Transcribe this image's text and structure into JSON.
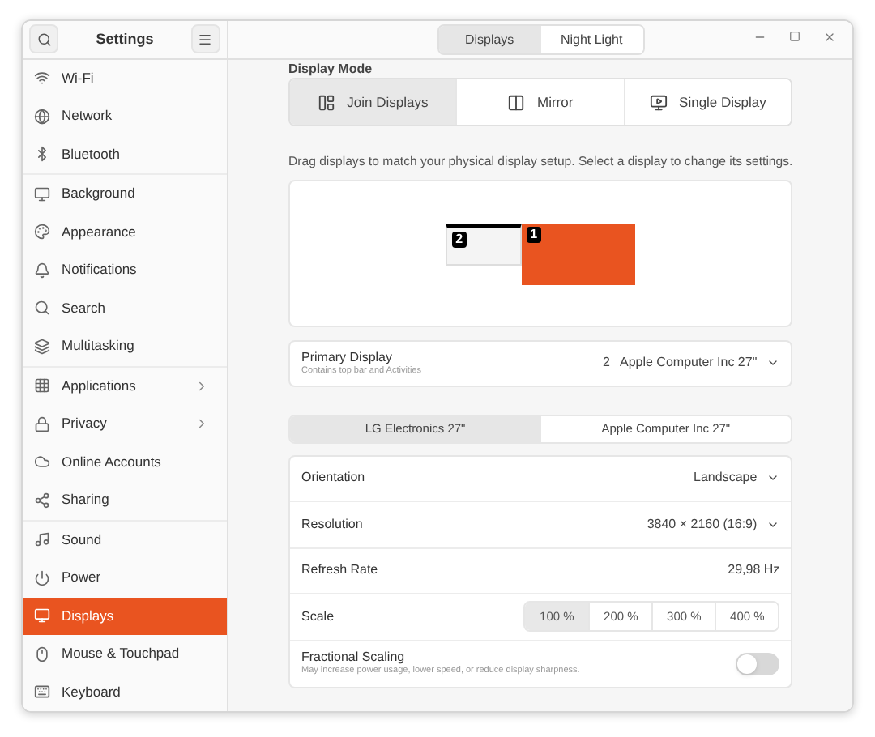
{
  "sidebar": {
    "title": "Settings",
    "groups": [
      [
        {
          "label": "Wi-Fi",
          "selected": false,
          "has_submenu": false
        },
        {
          "label": "Network",
          "selected": false,
          "has_submenu": false
        },
        {
          "label": "Bluetooth",
          "selected": false,
          "has_submenu": false
        }
      ],
      [
        {
          "label": "Background",
          "selected": false,
          "has_submenu": false
        },
        {
          "label": "Appearance",
          "selected": false,
          "has_submenu": false
        },
        {
          "label": "Notifications",
          "selected": false,
          "has_submenu": false
        },
        {
          "label": "Search",
          "selected": false,
          "has_submenu": false
        },
        {
          "label": "Multitasking",
          "selected": false,
          "has_submenu": false
        }
      ],
      [
        {
          "label": "Applications",
          "selected": false,
          "has_submenu": true
        },
        {
          "label": "Privacy",
          "selected": false,
          "has_submenu": true
        },
        {
          "label": "Online Accounts",
          "selected": false,
          "has_submenu": false
        },
        {
          "label": "Sharing",
          "selected": false,
          "has_submenu": false
        }
      ],
      [
        {
          "label": "Sound",
          "selected": false,
          "has_submenu": false
        },
        {
          "label": "Power",
          "selected": false,
          "has_submenu": false
        },
        {
          "label": "Displays",
          "selected": true,
          "has_submenu": false
        },
        {
          "label": "Mouse & Touchpad",
          "selected": false,
          "has_submenu": false
        },
        {
          "label": "Keyboard",
          "selected": false,
          "has_submenu": false
        }
      ]
    ]
  },
  "header": {
    "tabs": [
      {
        "label": "Displays",
        "selected": true
      },
      {
        "label": "Night Light",
        "selected": false
      }
    ]
  },
  "display_mode": {
    "heading": "Display Mode",
    "options": [
      {
        "label": "Join Displays",
        "selected": true
      },
      {
        "label": "Mirror",
        "selected": false
      },
      {
        "label": "Single Display",
        "selected": false
      }
    ],
    "description": "Drag displays to match your physical display setup. Select a display to change its settings."
  },
  "arrangement": {
    "displays": [
      {
        "number": "2",
        "selected": false,
        "primary": true
      },
      {
        "number": "1",
        "selected": true,
        "primary": false
      }
    ]
  },
  "primary_display": {
    "label": "Primary Display",
    "sublabel": "Contains top bar and Activities",
    "number": "2",
    "value": "Apple Computer Inc 27\""
  },
  "monitor_tabs": [
    {
      "label": "LG Electronics 27\"",
      "selected": true
    },
    {
      "label": "Apple Computer Inc 27\"",
      "selected": false
    }
  ],
  "settings": [
    {
      "kind": "dropdown",
      "label": "Orientation",
      "value": "Landscape"
    },
    {
      "kind": "dropdown",
      "label": "Resolution",
      "value": "3840 × 2160 (16:9)"
    },
    {
      "kind": "value",
      "label": "Refresh Rate",
      "value": "29,98 Hz"
    },
    {
      "kind": "scale",
      "label": "Scale",
      "options": [
        {
          "label": "100 %",
          "selected": true
        },
        {
          "label": "200 %",
          "selected": false
        },
        {
          "label": "300 %",
          "selected": false
        },
        {
          "label": "400 %",
          "selected": false
        }
      ]
    },
    {
      "kind": "toggle",
      "label": "Fractional Scaling",
      "sublabel": "May increase power usage, lower speed, or reduce display sharpness.",
      "on": false
    }
  ]
}
